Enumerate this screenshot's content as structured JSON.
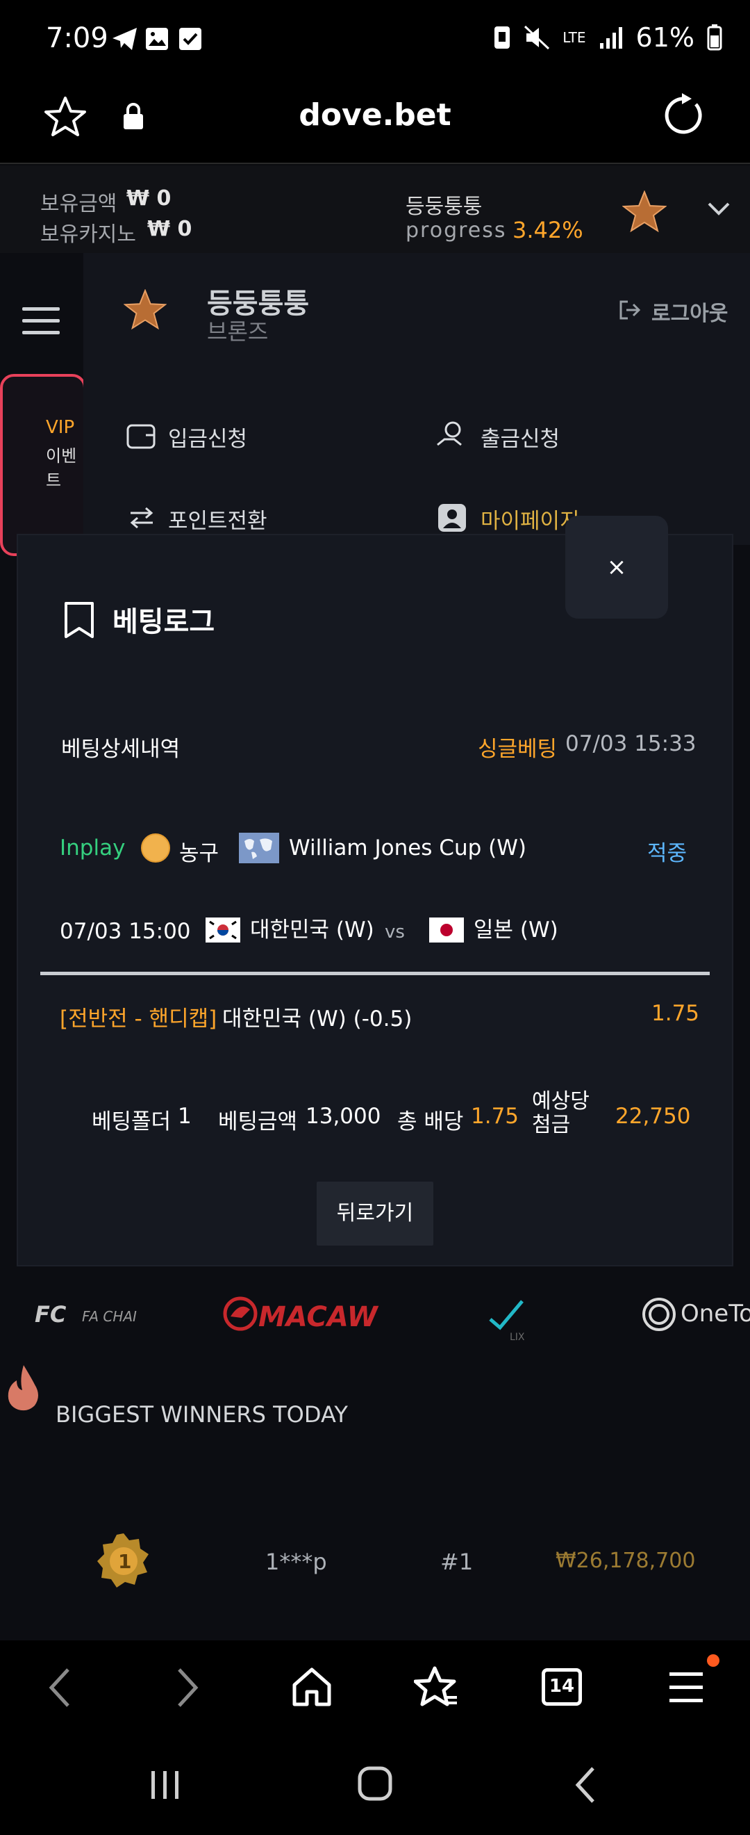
{
  "status_bar": {
    "time": "7:09",
    "network": "LTE",
    "battery": "61%"
  },
  "browser": {
    "url": "dove.bet"
  },
  "header": {
    "balance_label": "보유금액",
    "balance_value": "₩ 0",
    "casino_label": "보유카지노",
    "casino_value": "₩ 0",
    "username": "등둥퉁퉁",
    "progress_label": "progress",
    "progress_value": "3.42%"
  },
  "drawer": {
    "username": "등둥퉁퉁",
    "rank": "브론즈",
    "logout": "로그아웃",
    "deposit": "입금신청",
    "withdraw": "출금신청",
    "point_convert": "포인트전환",
    "mypage": "마이페이지",
    "bg_banner_title": "VIP",
    "bg_banner_sub": "이벤트"
  },
  "modal": {
    "close": "×",
    "title": "베팅로그",
    "detail_title": "베팅상세내역",
    "bet_type": "싱글베팅",
    "bet_datetime": "07/03 15:33",
    "status": "Inplay",
    "sport": "농구",
    "league": "William Jones Cup (W)",
    "result": "적중",
    "match_datetime": "07/03 15:00",
    "home_team": "대한민국 (W)",
    "vs": "vs",
    "away_team": "일본 (W)",
    "market": "[전반전 - 핸디캡]",
    "selection": "대한민국 (W) (-0.5)",
    "odds": "1.75",
    "folder_label": "베팅폴더",
    "folder_value": "1",
    "amount_label": "베팅금액",
    "amount_value": "13,000",
    "total_odds_label": "총 배당",
    "total_odds_value": "1.75",
    "expected_label_1": "예상당",
    "expected_label_2": "첨금",
    "expected_value": "22,750",
    "back_button": "뒤로가기"
  },
  "providers": [
    "FA CHAI",
    "MACAW",
    "LIX",
    "OneTo"
  ],
  "winners": {
    "title": "BIGGEST WINNERS TODAY",
    "rows": [
      {
        "medal": "1",
        "user": "1***p",
        "rank": "#1",
        "amount": "₩26,178,700"
      }
    ]
  },
  "bottom_nav": {
    "tabs_count": "14"
  },
  "colors": {
    "accent_orange": "#ffa62b",
    "inplay_green": "#35d07f",
    "result_blue": "#5db7ff",
    "modal_bg": "#151820"
  }
}
